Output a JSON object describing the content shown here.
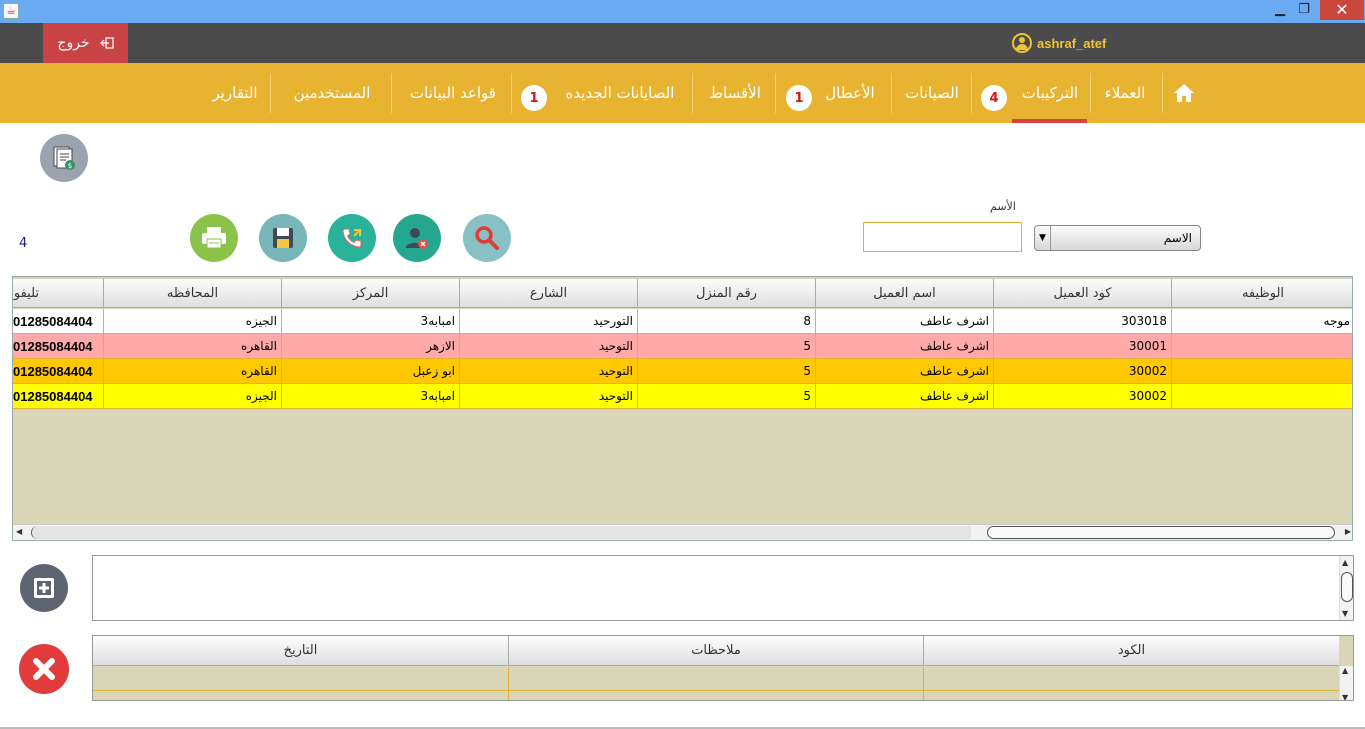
{
  "window": {
    "min": "▁",
    "max": "❐",
    "close": "✕",
    "java_icon": "☕"
  },
  "topbar": {
    "logout_label": "خروج",
    "username": "ashraf_atef"
  },
  "nav": {
    "items": [
      {
        "label": "العملاء"
      },
      {
        "label": "التركيبات",
        "badge": "4"
      },
      {
        "label": "الصيانات"
      },
      {
        "label": "الأعطال",
        "badge": "1"
      },
      {
        "label": "الأقساط"
      },
      {
        "label": "الصايانات الجديده",
        "badge": "1"
      },
      {
        "label": "قواعد البيانات"
      },
      {
        "label": "المستخدمين"
      },
      {
        "label": "التقارير"
      }
    ],
    "active": "التركيبات"
  },
  "search": {
    "label": "الأسم",
    "field_value": "",
    "combo_value": "الاسم"
  },
  "result_count": "4",
  "table": {
    "columns": [
      "الوظيفه",
      "كود العميل",
      "اسم العميل",
      "رقم المنزل",
      "الشارع",
      "المركز",
      "المحافظه",
      "تليفو"
    ],
    "rows": [
      {
        "job": "موجه",
        "code": "303018",
        "name": "اشرف عاطف",
        "house": "8",
        "street": "التورحيد",
        "center": "امبابه3",
        "gov": "الجيزه",
        "phone": "01285084404",
        "color": "#ffffff"
      },
      {
        "job": "",
        "code": "30001",
        "name": "اشرف عاطف",
        "house": "5",
        "street": "التوحيد",
        "center": "الازهر",
        "gov": "القاهره",
        "phone": "01285084404",
        "color": "#ffaaa9"
      },
      {
        "job": "",
        "code": "30002",
        "name": "اشرف عاطف",
        "house": "5",
        "street": "التوحيد",
        "center": "ابو زعبل",
        "gov": "القاهره",
        "phone": "01285084404",
        "color": "#ffc800"
      },
      {
        "job": "",
        "code": "30002",
        "name": "اشرف عاطف",
        "house": "5",
        "street": "التوحيد",
        "center": "امبابه3",
        "gov": "الجيزه",
        "phone": "01285084404",
        "color": "#ffff00"
      }
    ]
  },
  "notes_table": {
    "columns": [
      "الكود",
      "ملاحظات",
      "التاريخ"
    ]
  },
  "colors": {
    "titlebar": "#6aaaf2",
    "topbar": "#4b4b4b",
    "navbar": "#e9b332",
    "logout": "#c94344",
    "table_bg": "#d8d6b6"
  }
}
